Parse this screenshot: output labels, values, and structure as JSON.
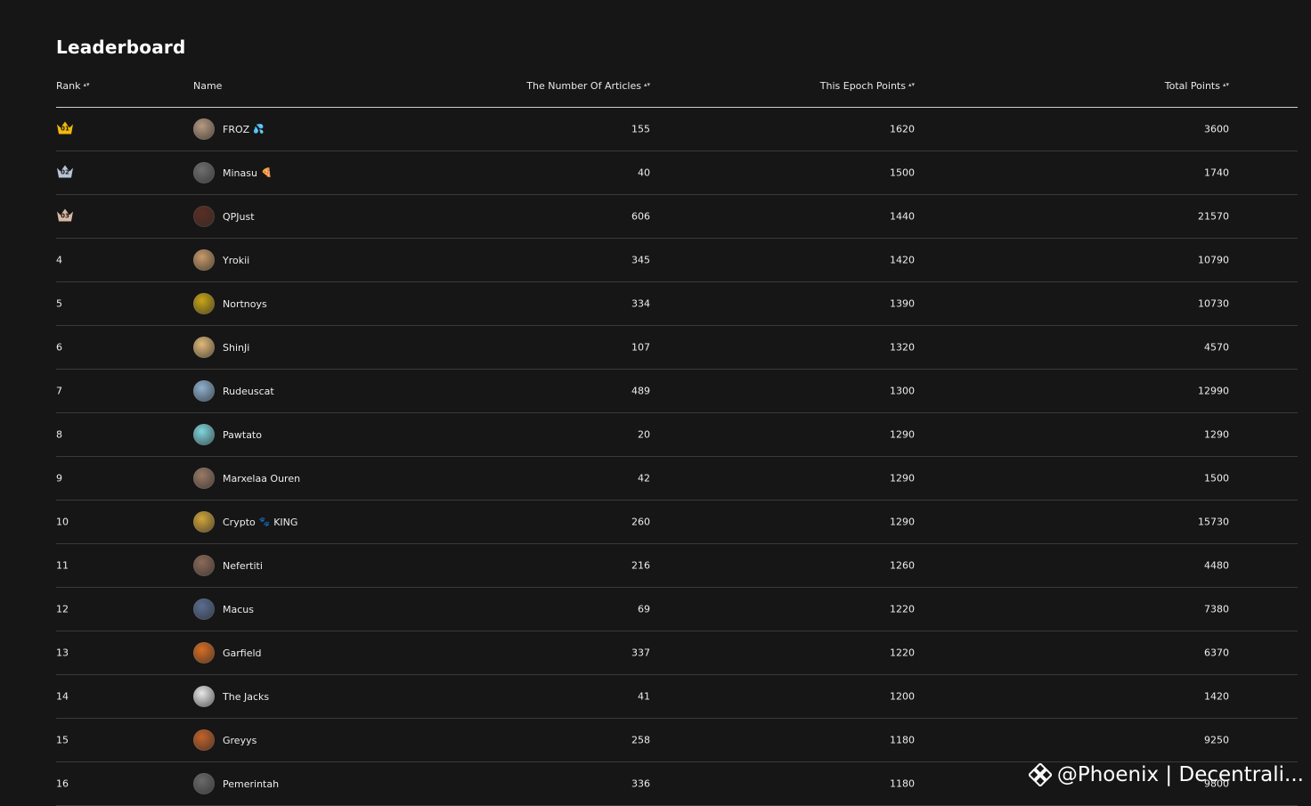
{
  "title": "Leaderboard",
  "columns": {
    "rank": "Rank",
    "name": "Name",
    "articles": "The Number Of Articles",
    "epoch": "This Epoch Points",
    "total": "Total Points"
  },
  "rows": [
    {
      "rank": "01",
      "medal": "gold",
      "name": "FROZ",
      "emoji": "💦",
      "articles": "155",
      "epoch": "1620",
      "total": "3600",
      "avatar_color": "#b79a82"
    },
    {
      "rank": "02",
      "medal": "silver",
      "name": "Minasu",
      "emoji": "🍕",
      "articles": "40",
      "epoch": "1500",
      "total": "1740",
      "avatar_color": "#6f6f6f"
    },
    {
      "rank": "03",
      "medal": "bronze",
      "name": "QPJust",
      "emoji": "",
      "articles": "606",
      "epoch": "1440",
      "total": "21570",
      "avatar_color": "#5a2e22"
    },
    {
      "rank": "4",
      "medal": "",
      "name": "Yrokii",
      "emoji": "",
      "articles": "345",
      "epoch": "1420",
      "total": "10790",
      "avatar_color": "#c79a6a"
    },
    {
      "rank": "5",
      "medal": "",
      "name": "Nortnoys",
      "emoji": "",
      "articles": "334",
      "epoch": "1390",
      "total": "10730",
      "avatar_color": "#c9a516"
    },
    {
      "rank": "6",
      "medal": "",
      "name": "ShinJi",
      "emoji": "",
      "articles": "107",
      "epoch": "1320",
      "total": "4570",
      "avatar_color": "#e0b978"
    },
    {
      "rank": "7",
      "medal": "",
      "name": "Rudeuscat",
      "emoji": "",
      "articles": "489",
      "epoch": "1300",
      "total": "12990",
      "avatar_color": "#8fb0cf"
    },
    {
      "rank": "8",
      "medal": "",
      "name": "Pawtato",
      "emoji": "",
      "articles": "20",
      "epoch": "1290",
      "total": "1290",
      "avatar_color": "#7fd6dc"
    },
    {
      "rank": "9",
      "medal": "",
      "name": "Marxelaa Ouren",
      "emoji": "",
      "articles": "42",
      "epoch": "1290",
      "total": "1500",
      "avatar_color": "#9a7a66"
    },
    {
      "rank": "10",
      "medal": "",
      "name": "Crypto",
      "emoji": "🐾",
      "suffix": "KING",
      "articles": "260",
      "epoch": "1290",
      "total": "15730",
      "avatar_color": "#d2a53a"
    },
    {
      "rank": "11",
      "medal": "",
      "name": "Nefertiti",
      "emoji": "",
      "articles": "216",
      "epoch": "1260",
      "total": "4480",
      "avatar_color": "#8c6a58"
    },
    {
      "rank": "12",
      "medal": "",
      "name": "Macus",
      "emoji": "",
      "articles": "69",
      "epoch": "1220",
      "total": "7380",
      "avatar_color": "#5a6e92"
    },
    {
      "rank": "13",
      "medal": "",
      "name": "Garfield",
      "emoji": "",
      "articles": "337",
      "epoch": "1220",
      "total": "6370",
      "avatar_color": "#d86d22"
    },
    {
      "rank": "14",
      "medal": "",
      "name": "The Jacks",
      "emoji": "",
      "articles": "41",
      "epoch": "1200",
      "total": "1420",
      "avatar_color": "#e8e8e8"
    },
    {
      "rank": "15",
      "medal": "",
      "name": "Greyys",
      "emoji": "",
      "articles": "258",
      "epoch": "1180",
      "total": "9250",
      "avatar_color": "#c4622a"
    },
    {
      "rank": "16",
      "medal": "",
      "name": "Pemerintah",
      "emoji": "",
      "articles": "336",
      "epoch": "1180",
      "total": "9800",
      "avatar_color": "#6a6a6a"
    }
  ],
  "medal_colors": {
    "gold": "#f0b90b",
    "silver": "#b8c4d4",
    "bronze": "#d9b9a3"
  },
  "watermark": {
    "text": "@Phoenix | Decentrali...",
    "icon": "binance-logo-icon"
  }
}
